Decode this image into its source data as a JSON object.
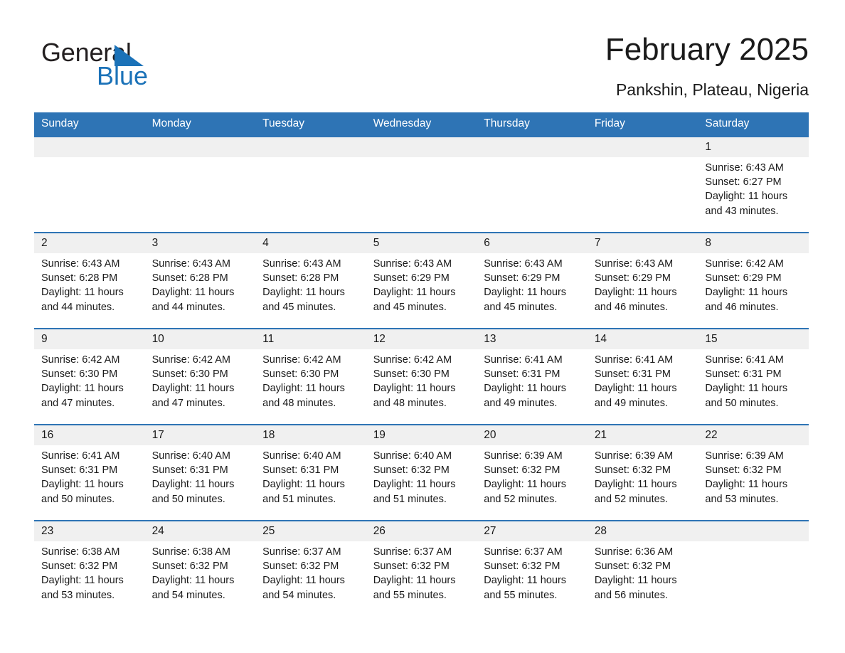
{
  "brand": {
    "name_part1": "General",
    "name_part2": "Blue",
    "triangle_icon": "triangle-icon",
    "colors": {
      "blue": "#1b72b8",
      "black": "#231f20"
    }
  },
  "header": {
    "title": "February 2025",
    "subtitle": "Pankshin, Plateau, Nigeria"
  },
  "calendar": {
    "accent_color": "#2e74b5",
    "daynum_band_color": "#f0f0f0",
    "weekdays": [
      "Sunday",
      "Monday",
      "Tuesday",
      "Wednesday",
      "Thursday",
      "Friday",
      "Saturday"
    ],
    "weeks": [
      [
        {
          "day": ""
        },
        {
          "day": ""
        },
        {
          "day": ""
        },
        {
          "day": ""
        },
        {
          "day": ""
        },
        {
          "day": ""
        },
        {
          "day": "1",
          "sunrise": "Sunrise: 6:43 AM",
          "sunset": "Sunset: 6:27 PM",
          "daylight": "Daylight: 11 hours and 43 minutes."
        }
      ],
      [
        {
          "day": "2",
          "sunrise": "Sunrise: 6:43 AM",
          "sunset": "Sunset: 6:28 PM",
          "daylight": "Daylight: 11 hours and 44 minutes."
        },
        {
          "day": "3",
          "sunrise": "Sunrise: 6:43 AM",
          "sunset": "Sunset: 6:28 PM",
          "daylight": "Daylight: 11 hours and 44 minutes."
        },
        {
          "day": "4",
          "sunrise": "Sunrise: 6:43 AM",
          "sunset": "Sunset: 6:28 PM",
          "daylight": "Daylight: 11 hours and 45 minutes."
        },
        {
          "day": "5",
          "sunrise": "Sunrise: 6:43 AM",
          "sunset": "Sunset: 6:29 PM",
          "daylight": "Daylight: 11 hours and 45 minutes."
        },
        {
          "day": "6",
          "sunrise": "Sunrise: 6:43 AM",
          "sunset": "Sunset: 6:29 PM",
          "daylight": "Daylight: 11 hours and 45 minutes."
        },
        {
          "day": "7",
          "sunrise": "Sunrise: 6:43 AM",
          "sunset": "Sunset: 6:29 PM",
          "daylight": "Daylight: 11 hours and 46 minutes."
        },
        {
          "day": "8",
          "sunrise": "Sunrise: 6:42 AM",
          "sunset": "Sunset: 6:29 PM",
          "daylight": "Daylight: 11 hours and 46 minutes."
        }
      ],
      [
        {
          "day": "9",
          "sunrise": "Sunrise: 6:42 AM",
          "sunset": "Sunset: 6:30 PM",
          "daylight": "Daylight: 11 hours and 47 minutes."
        },
        {
          "day": "10",
          "sunrise": "Sunrise: 6:42 AM",
          "sunset": "Sunset: 6:30 PM",
          "daylight": "Daylight: 11 hours and 47 minutes."
        },
        {
          "day": "11",
          "sunrise": "Sunrise: 6:42 AM",
          "sunset": "Sunset: 6:30 PM",
          "daylight": "Daylight: 11 hours and 48 minutes."
        },
        {
          "day": "12",
          "sunrise": "Sunrise: 6:42 AM",
          "sunset": "Sunset: 6:30 PM",
          "daylight": "Daylight: 11 hours and 48 minutes."
        },
        {
          "day": "13",
          "sunrise": "Sunrise: 6:41 AM",
          "sunset": "Sunset: 6:31 PM",
          "daylight": "Daylight: 11 hours and 49 minutes."
        },
        {
          "day": "14",
          "sunrise": "Sunrise: 6:41 AM",
          "sunset": "Sunset: 6:31 PM",
          "daylight": "Daylight: 11 hours and 49 minutes."
        },
        {
          "day": "15",
          "sunrise": "Sunrise: 6:41 AM",
          "sunset": "Sunset: 6:31 PM",
          "daylight": "Daylight: 11 hours and 50 minutes."
        }
      ],
      [
        {
          "day": "16",
          "sunrise": "Sunrise: 6:41 AM",
          "sunset": "Sunset: 6:31 PM",
          "daylight": "Daylight: 11 hours and 50 minutes."
        },
        {
          "day": "17",
          "sunrise": "Sunrise: 6:40 AM",
          "sunset": "Sunset: 6:31 PM",
          "daylight": "Daylight: 11 hours and 50 minutes."
        },
        {
          "day": "18",
          "sunrise": "Sunrise: 6:40 AM",
          "sunset": "Sunset: 6:31 PM",
          "daylight": "Daylight: 11 hours and 51 minutes."
        },
        {
          "day": "19",
          "sunrise": "Sunrise: 6:40 AM",
          "sunset": "Sunset: 6:32 PM",
          "daylight": "Daylight: 11 hours and 51 minutes."
        },
        {
          "day": "20",
          "sunrise": "Sunrise: 6:39 AM",
          "sunset": "Sunset: 6:32 PM",
          "daylight": "Daylight: 11 hours and 52 minutes."
        },
        {
          "day": "21",
          "sunrise": "Sunrise: 6:39 AM",
          "sunset": "Sunset: 6:32 PM",
          "daylight": "Daylight: 11 hours and 52 minutes."
        },
        {
          "day": "22",
          "sunrise": "Sunrise: 6:39 AM",
          "sunset": "Sunset: 6:32 PM",
          "daylight": "Daylight: 11 hours and 53 minutes."
        }
      ],
      [
        {
          "day": "23",
          "sunrise": "Sunrise: 6:38 AM",
          "sunset": "Sunset: 6:32 PM",
          "daylight": "Daylight: 11 hours and 53 minutes."
        },
        {
          "day": "24",
          "sunrise": "Sunrise: 6:38 AM",
          "sunset": "Sunset: 6:32 PM",
          "daylight": "Daylight: 11 hours and 54 minutes."
        },
        {
          "day": "25",
          "sunrise": "Sunrise: 6:37 AM",
          "sunset": "Sunset: 6:32 PM",
          "daylight": "Daylight: 11 hours and 54 minutes."
        },
        {
          "day": "26",
          "sunrise": "Sunrise: 6:37 AM",
          "sunset": "Sunset: 6:32 PM",
          "daylight": "Daylight: 11 hours and 55 minutes."
        },
        {
          "day": "27",
          "sunrise": "Sunrise: 6:37 AM",
          "sunset": "Sunset: 6:32 PM",
          "daylight": "Daylight: 11 hours and 55 minutes."
        },
        {
          "day": "28",
          "sunrise": "Sunrise: 6:36 AM",
          "sunset": "Sunset: 6:32 PM",
          "daylight": "Daylight: 11 hours and 56 minutes."
        },
        {
          "day": ""
        }
      ]
    ]
  }
}
